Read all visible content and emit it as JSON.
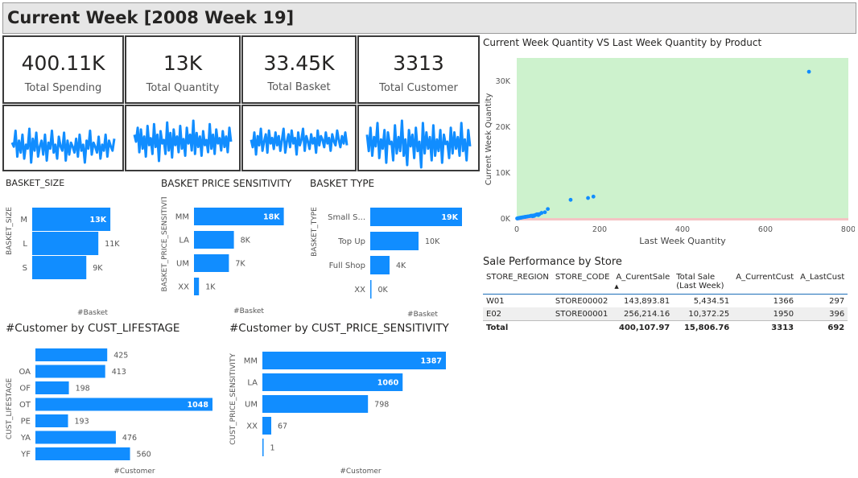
{
  "header": {
    "title": "Current Week [2008 Week 19]"
  },
  "kpis": [
    {
      "value": "400.11K",
      "label": "Total Spending"
    },
    {
      "value": "13K",
      "label": "Total Quantity"
    },
    {
      "value": "33.45K",
      "label": "Total Basket"
    },
    {
      "value": "3313",
      "label": "Total Customer"
    }
  ],
  "colors": {
    "bar": "#118DFF",
    "scatter_bg": "#cdf2cd",
    "accent": "#1d6fb8"
  },
  "chart_data": [
    {
      "type": "bar",
      "orientation": "horizontal",
      "title": "BASKET_SIZE",
      "ylabel": "BASKET_SIZE",
      "xlabel": "#Basket",
      "categories": [
        "M",
        "L",
        "S"
      ],
      "values": [
        13,
        11,
        9
      ],
      "value_labels": [
        "13K",
        "11K",
        "9K"
      ],
      "xlim": [
        0,
        17
      ]
    },
    {
      "type": "bar",
      "orientation": "horizontal",
      "title": "BASKET PRICE SENSITIVITY",
      "ylabel": "BASKET_PRICE_SENSITIVITY",
      "xlabel": "#Basket",
      "categories": [
        "MM",
        "LA",
        "UM",
        "XX"
      ],
      "values": [
        18,
        8,
        7,
        1
      ],
      "value_labels": [
        "18K",
        "8K",
        "7K",
        "1K"
      ],
      "xlim": [
        0,
        20
      ]
    },
    {
      "type": "bar",
      "orientation": "horizontal",
      "title": "BASKET TYPE",
      "ylabel": "BASKET_TYPE",
      "xlabel": "#Basket",
      "categories": [
        "Small S...",
        "Top Up",
        "Full Shop",
        "XX"
      ],
      "values": [
        19,
        10,
        4,
        0
      ],
      "value_labels": [
        "19K",
        "10K",
        "4K",
        "0K"
      ],
      "xlim": [
        0,
        20
      ]
    },
    {
      "type": "bar",
      "orientation": "horizontal",
      "title": "#Customer by CUST_LIFESTAGE",
      "ylabel": "CUST_LIFESTAGE",
      "xlabel": "#Customer",
      "categories": [
        "",
        "OA",
        "OF",
        "OT",
        "PE",
        "YA",
        "YF"
      ],
      "values": [
        425,
        413,
        198,
        1048,
        193,
        476,
        560
      ],
      "value_labels": [
        "425",
        "413",
        "198",
        "1048",
        "193",
        "476",
        "560"
      ],
      "xlim": [
        0,
        1048
      ]
    },
    {
      "type": "bar",
      "orientation": "horizontal",
      "title": "#Customer by CUST_PRICE_SENSITIVITY",
      "ylabel": "CUST_PRICE_SENSITIVITY",
      "xlabel": "#Customer",
      "categories": [
        "MM",
        "LA",
        "UM",
        "XX",
        ""
      ],
      "values": [
        1387,
        1060,
        798,
        67,
        1
      ],
      "value_labels": [
        "1387",
        "1060",
        "798",
        "67",
        "1"
      ],
      "xlim": [
        0,
        1387
      ]
    },
    {
      "type": "scatter",
      "title": "Current Week Quantity VS Last Week Quantity by Product",
      "xlabel": "Last Week Quantity",
      "ylabel": "Current Week Quantity",
      "xlim": [
        0,
        800
      ],
      "ylim": [
        -400,
        35000
      ],
      "x_ticks": [
        "0",
        "200",
        "400",
        "600",
        "800"
      ],
      "y_ticks": [
        "0K",
        "10K",
        "20K",
        "30K"
      ],
      "points": [
        [
          705,
          32000
        ],
        [
          185,
          4800
        ],
        [
          172,
          4500
        ],
        [
          130,
          4100
        ],
        [
          75,
          2100
        ],
        [
          68,
          1400
        ],
        [
          60,
          1250
        ],
        [
          55,
          1000
        ],
        [
          50,
          950
        ],
        [
          45,
          800
        ],
        [
          40,
          700
        ],
        [
          35,
          650
        ],
        [
          32,
          550
        ],
        [
          28,
          500
        ],
        [
          25,
          450
        ],
        [
          22,
          400
        ],
        [
          20,
          380
        ],
        [
          18,
          350
        ],
        [
          15,
          300
        ],
        [
          12,
          250
        ],
        [
          10,
          200
        ],
        [
          8,
          180
        ],
        [
          6,
          150
        ],
        [
          5,
          120
        ],
        [
          4,
          100
        ],
        [
          3,
          80
        ],
        [
          2,
          60
        ],
        [
          1,
          40
        ],
        [
          38,
          520
        ],
        [
          42,
          600
        ],
        [
          48,
          900
        ],
        [
          52,
          780
        ]
      ]
    }
  ],
  "sparklines": [
    [
      62,
      60,
      68,
      55,
      63,
      57,
      66,
      54,
      61,
      59,
      69,
      52,
      64,
      58,
      67,
      55,
      60,
      63,
      56,
      66,
      53,
      62,
      59,
      68,
      57,
      61,
      54,
      65,
      60,
      58,
      67,
      53,
      63,
      56,
      62,
      60,
      57,
      64,
      55,
      66,
      58,
      61,
      52,
      63,
      59,
      68,
      56,
      62,
      60,
      57,
      65,
      54,
      61,
      58,
      66,
      55,
      63,
      60,
      58,
      64
    ],
    [
      60,
      52,
      68,
      40,
      66,
      44,
      58,
      35,
      70,
      48,
      56,
      38,
      72,
      46,
      60,
      30,
      64,
      50,
      54,
      38,
      74,
      42,
      62,
      34,
      66,
      48,
      58,
      40,
      70,
      44,
      55,
      36,
      68,
      50,
      60,
      42,
      76,
      38,
      62,
      46,
      58,
      36,
      64,
      48,
      54,
      40,
      72,
      44,
      60,
      38,
      66,
      50,
      56,
      42,
      64,
      46,
      58,
      40,
      68,
      52
    ],
    [
      58,
      54,
      62,
      50,
      60,
      55,
      64,
      52,
      57,
      61,
      51,
      63,
      56,
      59,
      53,
      62,
      55,
      60,
      52,
      58,
      64,
      51,
      57,
      61,
      54,
      63,
      56,
      59,
      50,
      62,
      55,
      58,
      64,
      52,
      60,
      57,
      53,
      61,
      56,
      59,
      51,
      63,
      55,
      60,
      58,
      54,
      62,
      56,
      59,
      52,
      61,
      57,
      55,
      63,
      58,
      54,
      60,
      56,
      62,
      55
    ],
    [
      64,
      50,
      70,
      46,
      62,
      54,
      74,
      44,
      60,
      52,
      68,
      40,
      66,
      56,
      58,
      42,
      72,
      48,
      62,
      50,
      76,
      46,
      60,
      38,
      68,
      54,
      64,
      44,
      70,
      50,
      58,
      36,
      74,
      48,
      66,
      52,
      62,
      42,
      72,
      46,
      60,
      50,
      68,
      40,
      64,
      56,
      58,
      44,
      70,
      48,
      66,
      52,
      62,
      46,
      74,
      50,
      60,
      42,
      68,
      54
    ]
  ],
  "sale_table": {
    "title": "Sale Performance by Store",
    "columns": [
      "STORE_REGION",
      "STORE_CODE",
      "A_CurentSale",
      "Total Sale (Last Week)",
      "A_CurrentCust",
      "A_LastCust"
    ],
    "rows": [
      [
        "W01",
        "STORE00002",
        "143,893.81",
        "5,434.51",
        "1366",
        "297"
      ],
      [
        "E02",
        "STORE00001",
        "256,214.16",
        "10,372.25",
        "1950",
        "396"
      ]
    ],
    "total": [
      "Total",
      "",
      "400,107.97",
      "15,806.76",
      "3313",
      "692"
    ],
    "sort_indicator": "▲"
  }
}
